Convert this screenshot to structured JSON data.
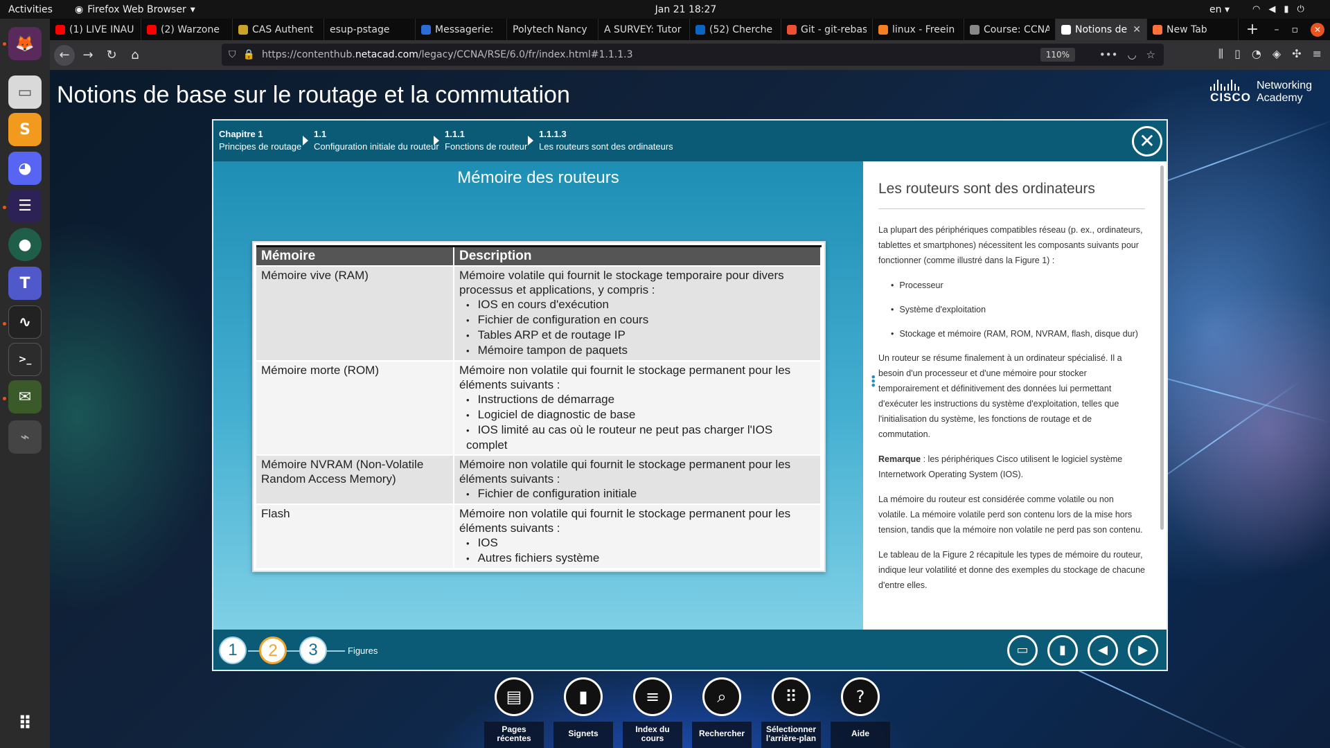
{
  "system": {
    "activities": "Activities",
    "app_name": "Firefox Web Browser",
    "clock": "Jan 21  18:27",
    "language": "en"
  },
  "browser": {
    "tabs": [
      {
        "label": "(1) LIVE INAU",
        "icon": "youtube-icon",
        "color": "#ff0000"
      },
      {
        "label": "(2) Warzone",
        "icon": "youtube-icon",
        "color": "#ff0000"
      },
      {
        "label": "CAS Authent",
        "icon": "cas-icon",
        "color": "#c9a227"
      },
      {
        "label": "esup-pstage",
        "icon": "",
        "color": ""
      },
      {
        "label": "Messagerie:",
        "icon": "zimbra-icon",
        "color": "#2a6dd6"
      },
      {
        "label": "Polytech Nancy",
        "icon": "",
        "color": ""
      },
      {
        "label": "A SURVEY: Tutor",
        "icon": "",
        "color": ""
      },
      {
        "label": "(52) Cherche",
        "icon": "linkedin-icon",
        "color": "#0a66c2"
      },
      {
        "label": "Git - git-rebas",
        "icon": "git-icon",
        "color": "#f14e32"
      },
      {
        "label": "linux - Freein",
        "icon": "stackoverflow-icon",
        "color": "#f48024"
      },
      {
        "label": "Course: CCNA",
        "icon": "moodle-icon",
        "color": "#888888"
      },
      {
        "label": "Notions de",
        "icon": "netacad-icon",
        "color": "#ffffff"
      },
      {
        "label": "New Tab",
        "icon": "firefox-icon",
        "color": "#ff7139"
      }
    ],
    "url_prefix": "https://contenthub.",
    "url_host": "netacad.com",
    "url_suffix": "/legacy/CCNA/RSE/6.0/fr/index.html#1.1.1.3",
    "zoom": "110%"
  },
  "page": {
    "title": "Notions de base sur le routage et la commutation",
    "brand_word": "CISCO",
    "brand_line1": "Networking",
    "brand_line2": "Academy"
  },
  "breadcrumb": [
    {
      "num": "Chapitre 1",
      "title": "Principes de routage"
    },
    {
      "num": "1.1",
      "title": "Configuration initiale du routeur"
    },
    {
      "num": "1.1.1",
      "title": "Fonctions de routeur"
    },
    {
      "num": "1.1.1.3",
      "title": "Les routeurs sont des ordinateurs"
    }
  ],
  "figure": {
    "title": "Mémoire des routeurs",
    "table": {
      "headers": [
        "Mémoire",
        "Description"
      ],
      "rows": [
        {
          "memory": "Mémoire vive (RAM)",
          "desc": "Mémoire volatile qui fournit le stockage temporaire pour divers processus et applications, y compris :",
          "items": [
            "IOS en cours d'exécution",
            "Fichier de configuration en cours",
            "Tables ARP et de routage IP",
            "Mémoire tampon de paquets"
          ]
        },
        {
          "memory": "Mémoire morte (ROM)",
          "desc": "Mémoire non volatile qui fournit le stockage permanent pour les éléments suivants :",
          "items": [
            "Instructions de démarrage",
            "Logiciel de diagnostic de base",
            "IOS limité au cas où le routeur ne peut pas charger l'IOS complet"
          ]
        },
        {
          "memory": "Mémoire NVRAM (Non-Volatile Random Access Memory)",
          "desc": "Mémoire non volatile qui fournit le stockage permanent pour les éléments suivants :",
          "items": [
            "Fichier de configuration initiale"
          ]
        },
        {
          "memory": "Flash",
          "desc": "Mémoire non volatile qui fournit le stockage permanent pour les éléments suivants :",
          "items": [
            "IOS",
            "Autres fichiers système"
          ]
        }
      ]
    },
    "nav": [
      "1",
      "2",
      "3"
    ],
    "nav_selected": "2",
    "nav_label": "Figures"
  },
  "text_panel": {
    "heading": "Les routeurs sont des ordinateurs",
    "p1": "La plupart des périphériques compatibles réseau (p. ex., ordinateurs, tablettes et smartphones) nécessitent les composants suivants pour fonctionner (comme illustré dans la Figure 1) :",
    "bullets": [
      "Processeur",
      "Système d'exploitation",
      "Stockage et mémoire (RAM, ROM, NVRAM, flash, disque dur)"
    ],
    "p2": "Un routeur se résume finalement à un ordinateur spécialisé. Il a besoin d'un processeur et d'une mémoire pour stocker temporairement et définitivement des données lui permettant d'exécuter les instructions du système d'exploitation, telles que l'initialisation du système, les fonctions de routage et de commutation.",
    "note_label": "Remarque",
    "note_text": " : les périphériques Cisco utilisent le logiciel système Internetwork Operating System (IOS).",
    "p3": "La mémoire du routeur est considérée comme volatile ou non volatile. La mémoire volatile perd son contenu lors de la mise hors tension, tandis que la mémoire non volatile ne perd pas son contenu.",
    "p4": "Le tableau de la Figure 2 récapitule les types de mémoire du routeur, indique leur volatilité et donne des exemples du stockage de chacune d'entre elles."
  },
  "bottom_toolbar": [
    {
      "label_1": "Pages",
      "label_2": "récentes",
      "icon": "pages-icon"
    },
    {
      "label_1": "Signets",
      "label_2": "",
      "icon": "bookmark-icon"
    },
    {
      "label_1": "Index du",
      "label_2": "cours",
      "icon": "menu-icon"
    },
    {
      "label_1": "Rechercher",
      "label_2": "",
      "icon": "search-icon"
    },
    {
      "label_1": "Sélectionner",
      "label_2": "l'arrière-plan",
      "icon": "grid-icon"
    },
    {
      "label_1": "Aide",
      "label_2": "",
      "icon": "help-icon"
    }
  ]
}
